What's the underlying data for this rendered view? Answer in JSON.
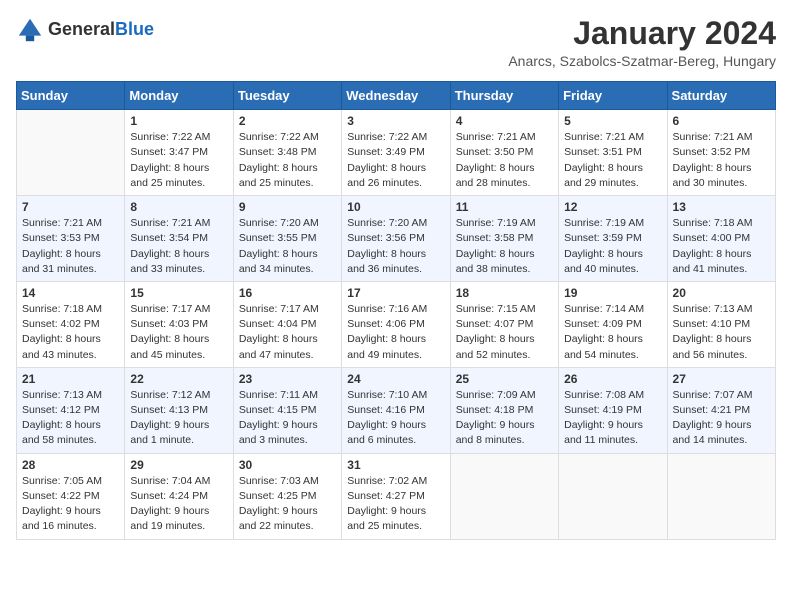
{
  "logo": {
    "general": "General",
    "blue": "Blue"
  },
  "title": "January 2024",
  "subtitle": "Anarcs, Szabolcs-Szatmar-Bereg, Hungary",
  "days": [
    "Sunday",
    "Monday",
    "Tuesday",
    "Wednesday",
    "Thursday",
    "Friday",
    "Saturday"
  ],
  "weeks": [
    [
      {
        "day": "",
        "sunrise": "",
        "sunset": "",
        "daylight": ""
      },
      {
        "day": "1",
        "sunrise": "Sunrise: 7:22 AM",
        "sunset": "Sunset: 3:47 PM",
        "daylight": "Daylight: 8 hours and 25 minutes."
      },
      {
        "day": "2",
        "sunrise": "Sunrise: 7:22 AM",
        "sunset": "Sunset: 3:48 PM",
        "daylight": "Daylight: 8 hours and 25 minutes."
      },
      {
        "day": "3",
        "sunrise": "Sunrise: 7:22 AM",
        "sunset": "Sunset: 3:49 PM",
        "daylight": "Daylight: 8 hours and 26 minutes."
      },
      {
        "day": "4",
        "sunrise": "Sunrise: 7:21 AM",
        "sunset": "Sunset: 3:50 PM",
        "daylight": "Daylight: 8 hours and 28 minutes."
      },
      {
        "day": "5",
        "sunrise": "Sunrise: 7:21 AM",
        "sunset": "Sunset: 3:51 PM",
        "daylight": "Daylight: 8 hours and 29 minutes."
      },
      {
        "day": "6",
        "sunrise": "Sunrise: 7:21 AM",
        "sunset": "Sunset: 3:52 PM",
        "daylight": "Daylight: 8 hours and 30 minutes."
      }
    ],
    [
      {
        "day": "7",
        "sunrise": "Sunrise: 7:21 AM",
        "sunset": "Sunset: 3:53 PM",
        "daylight": "Daylight: 8 hours and 31 minutes."
      },
      {
        "day": "8",
        "sunrise": "Sunrise: 7:21 AM",
        "sunset": "Sunset: 3:54 PM",
        "daylight": "Daylight: 8 hours and 33 minutes."
      },
      {
        "day": "9",
        "sunrise": "Sunrise: 7:20 AM",
        "sunset": "Sunset: 3:55 PM",
        "daylight": "Daylight: 8 hours and 34 minutes."
      },
      {
        "day": "10",
        "sunrise": "Sunrise: 7:20 AM",
        "sunset": "Sunset: 3:56 PM",
        "daylight": "Daylight: 8 hours and 36 minutes."
      },
      {
        "day": "11",
        "sunrise": "Sunrise: 7:19 AM",
        "sunset": "Sunset: 3:58 PM",
        "daylight": "Daylight: 8 hours and 38 minutes."
      },
      {
        "day": "12",
        "sunrise": "Sunrise: 7:19 AM",
        "sunset": "Sunset: 3:59 PM",
        "daylight": "Daylight: 8 hours and 40 minutes."
      },
      {
        "day": "13",
        "sunrise": "Sunrise: 7:18 AM",
        "sunset": "Sunset: 4:00 PM",
        "daylight": "Daylight: 8 hours and 41 minutes."
      }
    ],
    [
      {
        "day": "14",
        "sunrise": "Sunrise: 7:18 AM",
        "sunset": "Sunset: 4:02 PM",
        "daylight": "Daylight: 8 hours and 43 minutes."
      },
      {
        "day": "15",
        "sunrise": "Sunrise: 7:17 AM",
        "sunset": "Sunset: 4:03 PM",
        "daylight": "Daylight: 8 hours and 45 minutes."
      },
      {
        "day": "16",
        "sunrise": "Sunrise: 7:17 AM",
        "sunset": "Sunset: 4:04 PM",
        "daylight": "Daylight: 8 hours and 47 minutes."
      },
      {
        "day": "17",
        "sunrise": "Sunrise: 7:16 AM",
        "sunset": "Sunset: 4:06 PM",
        "daylight": "Daylight: 8 hours and 49 minutes."
      },
      {
        "day": "18",
        "sunrise": "Sunrise: 7:15 AM",
        "sunset": "Sunset: 4:07 PM",
        "daylight": "Daylight: 8 hours and 52 minutes."
      },
      {
        "day": "19",
        "sunrise": "Sunrise: 7:14 AM",
        "sunset": "Sunset: 4:09 PM",
        "daylight": "Daylight: 8 hours and 54 minutes."
      },
      {
        "day": "20",
        "sunrise": "Sunrise: 7:13 AM",
        "sunset": "Sunset: 4:10 PM",
        "daylight": "Daylight: 8 hours and 56 minutes."
      }
    ],
    [
      {
        "day": "21",
        "sunrise": "Sunrise: 7:13 AM",
        "sunset": "Sunset: 4:12 PM",
        "daylight": "Daylight: 8 hours and 58 minutes."
      },
      {
        "day": "22",
        "sunrise": "Sunrise: 7:12 AM",
        "sunset": "Sunset: 4:13 PM",
        "daylight": "Daylight: 9 hours and 1 minute."
      },
      {
        "day": "23",
        "sunrise": "Sunrise: 7:11 AM",
        "sunset": "Sunset: 4:15 PM",
        "daylight": "Daylight: 9 hours and 3 minutes."
      },
      {
        "day": "24",
        "sunrise": "Sunrise: 7:10 AM",
        "sunset": "Sunset: 4:16 PM",
        "daylight": "Daylight: 9 hours and 6 minutes."
      },
      {
        "day": "25",
        "sunrise": "Sunrise: 7:09 AM",
        "sunset": "Sunset: 4:18 PM",
        "daylight": "Daylight: 9 hours and 8 minutes."
      },
      {
        "day": "26",
        "sunrise": "Sunrise: 7:08 AM",
        "sunset": "Sunset: 4:19 PM",
        "daylight": "Daylight: 9 hours and 11 minutes."
      },
      {
        "day": "27",
        "sunrise": "Sunrise: 7:07 AM",
        "sunset": "Sunset: 4:21 PM",
        "daylight": "Daylight: 9 hours and 14 minutes."
      }
    ],
    [
      {
        "day": "28",
        "sunrise": "Sunrise: 7:05 AM",
        "sunset": "Sunset: 4:22 PM",
        "daylight": "Daylight: 9 hours and 16 minutes."
      },
      {
        "day": "29",
        "sunrise": "Sunrise: 7:04 AM",
        "sunset": "Sunset: 4:24 PM",
        "daylight": "Daylight: 9 hours and 19 minutes."
      },
      {
        "day": "30",
        "sunrise": "Sunrise: 7:03 AM",
        "sunset": "Sunset: 4:25 PM",
        "daylight": "Daylight: 9 hours and 22 minutes."
      },
      {
        "day": "31",
        "sunrise": "Sunrise: 7:02 AM",
        "sunset": "Sunset: 4:27 PM",
        "daylight": "Daylight: 9 hours and 25 minutes."
      },
      {
        "day": "",
        "sunrise": "",
        "sunset": "",
        "daylight": ""
      },
      {
        "day": "",
        "sunrise": "",
        "sunset": "",
        "daylight": ""
      },
      {
        "day": "",
        "sunrise": "",
        "sunset": "",
        "daylight": ""
      }
    ]
  ]
}
